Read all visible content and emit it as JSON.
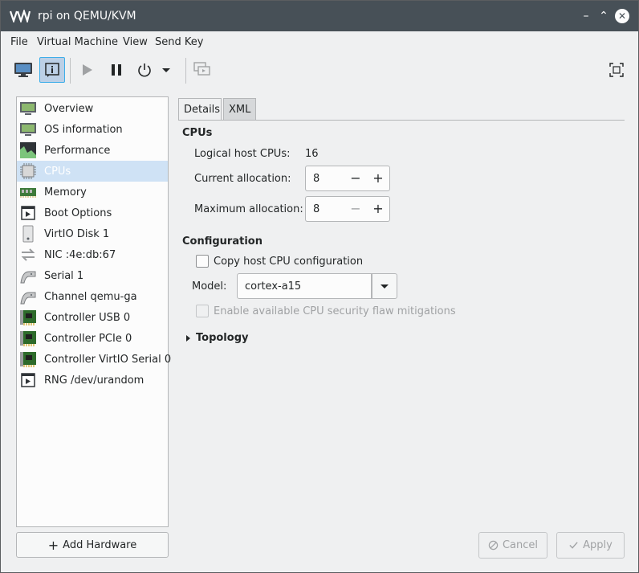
{
  "window": {
    "title": "rpi on QEMU/KVM"
  },
  "menubar": {
    "items": [
      "File",
      "Virtual Machine",
      "View",
      "Send Key"
    ]
  },
  "sidebar": {
    "items": [
      {
        "label": "Overview",
        "icon": "monitor-icon"
      },
      {
        "label": "OS information",
        "icon": "monitor-icon"
      },
      {
        "label": "Performance",
        "icon": "performance-graph-icon"
      },
      {
        "label": "CPUs",
        "icon": "cpu-chip-icon",
        "selected": true
      },
      {
        "label": "Memory",
        "icon": "memory-icon"
      },
      {
        "label": "Boot Options",
        "icon": "boot-icon"
      },
      {
        "label": "VirtIO Disk 1",
        "icon": "disk-icon"
      },
      {
        "label": "NIC :4e:db:67",
        "icon": "network-icon"
      },
      {
        "label": "Serial 1",
        "icon": "serial-icon"
      },
      {
        "label": "Channel qemu-ga",
        "icon": "serial-icon"
      },
      {
        "label": "Controller USB 0",
        "icon": "controller-card-icon"
      },
      {
        "label": "Controller PCIe 0",
        "icon": "controller-card-icon"
      },
      {
        "label": "Controller VirtIO Serial 0",
        "icon": "controller-card-icon"
      },
      {
        "label": "RNG /dev/urandom",
        "icon": "boot-icon"
      }
    ],
    "add_hardware": "Add Hardware"
  },
  "tabs": {
    "details": "Details",
    "xml": "XML"
  },
  "cpus": {
    "heading": "CPUs",
    "logical_host_label": "Logical host CPUs:",
    "logical_host_value": "16",
    "current_label": "Current allocation:",
    "current_value": "8",
    "maximum_label": "Maximum allocation:",
    "maximum_value": "8"
  },
  "configuration": {
    "heading": "Configuration",
    "copy_host_label": "Copy host CPU configuration",
    "model_label": "Model:",
    "model_value": "cortex-a15",
    "mitigations_label": "Enable available CPU security flaw mitigations"
  },
  "topology": {
    "label": "Topology"
  },
  "buttons": {
    "cancel": "Cancel",
    "apply": "Apply"
  },
  "colors": {
    "titlebar": "#475057",
    "selection": "#cfe2f5",
    "accent": "#3daee9"
  }
}
